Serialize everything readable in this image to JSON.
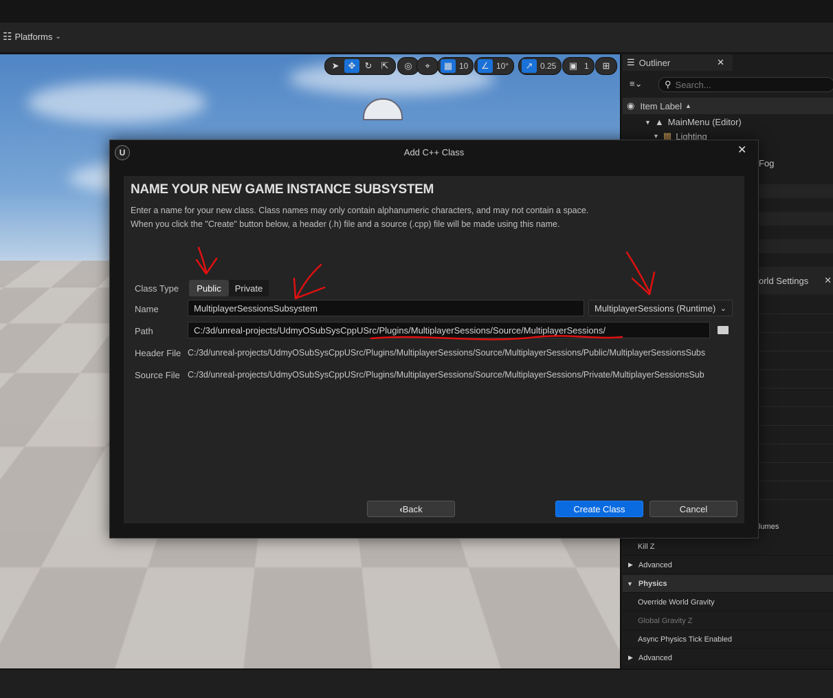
{
  "toolbar": {
    "platforms_label": "Platforms"
  },
  "viewport": {
    "grid_snap_value": "10",
    "rotation_snap_value": "10°",
    "scale_snap_value": "0.25",
    "camera_speed_value": "1"
  },
  "outliner": {
    "tab_label": "Outliner",
    "search_placeholder": "Search...",
    "column_header": "Item Label",
    "items": [
      {
        "label": "MainMenu (Editor)"
      },
      {
        "label": "Lighting"
      }
    ],
    "partial_fog_label": "Fog"
  },
  "world_settings": {
    "tab_label": "orld Settings",
    "partial_volumes_label": "lumes",
    "rows": [
      {
        "label": "Kill Z"
      },
      {
        "label": "Advanced"
      },
      {
        "label": "Physics"
      },
      {
        "label": "Override World Gravity"
      },
      {
        "label": "Global Gravity Z"
      },
      {
        "label": "Async Physics Tick Enabled"
      },
      {
        "label": "Advanced"
      }
    ]
  },
  "dialog": {
    "title": "Add C++ Class",
    "heading": "NAME YOUR NEW GAME INSTANCE SUBSYSTEM",
    "description_line1": "Enter a name for your new class. Class names may only contain alphanumeric characters, and may not contain a space.",
    "description_line2": "When you click the \"Create\" button below, a header (.h) file and a source (.cpp) file will be made using this name.",
    "class_type_label": "Class Type",
    "class_type_options": [
      "Public",
      "Private"
    ],
    "name_label": "Name",
    "name_value": "MultiplayerSessionsSubsystem",
    "module_selected": "MultiplayerSessions (Runtime)",
    "path_label": "Path",
    "path_value": "C:/3d/unreal-projects/UdmyOSubSysCppUSrc/Plugins/MultiplayerSessions/Source/MultiplayerSessions/",
    "header_file_label": "Header File",
    "header_file_value": "C:/3d/unreal-projects/UdmyOSubSysCppUSrc/Plugins/MultiplayerSessions/Source/MultiplayerSessions/Public/MultiplayerSessionsSubs",
    "source_file_label": "Source File",
    "source_file_value": "C:/3d/unreal-projects/UdmyOSubSysCppUSrc/Plugins/MultiplayerSessions/Source/MultiplayerSessions/Private/MultiplayerSessionsSub",
    "back_label": "Back",
    "create_label": "Create Class",
    "cancel_label": "Cancel"
  },
  "colors": {
    "accent_blue": "#0a6ae0",
    "annotation_red": "#e01010"
  }
}
